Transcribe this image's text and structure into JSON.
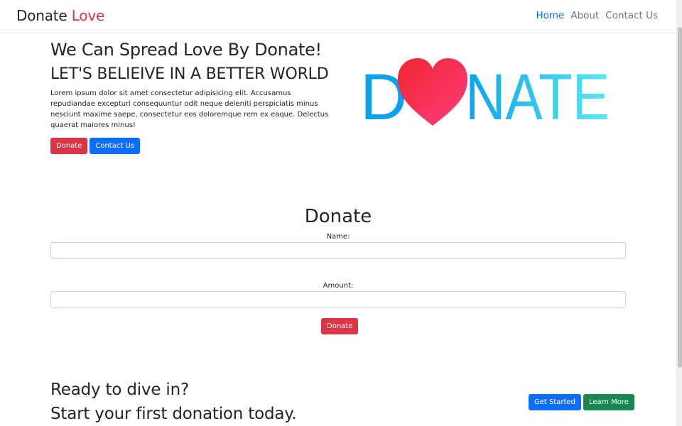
{
  "navbar": {
    "brand_main": "Donate",
    "brand_accent": "Love",
    "links": [
      "Home",
      "About",
      "Contact Us"
    ]
  },
  "hero": {
    "heading": "We Can Spread Love By Donate!",
    "subheading": "LET'S BELIEIVE IN A BETTER WORLD",
    "body": "Lorem ipsum dolor sit amet consectetur adipisicing elit. Accusamus repudiandae excepturi consequuntur odit neque deleniti perspiciatis minus nesciunt maxime saepe, consectetur eos doloremque rem ex eaque. Delectus quaerat maiores minus!",
    "donate_button": "Donate",
    "contact_button": "Contact Us"
  },
  "logo": {
    "letters_left": "D",
    "letters_right": "NATE"
  },
  "form": {
    "title": "Donate",
    "name_label": "Name:",
    "name_value": "",
    "amount_label": "Amount:",
    "amount_value": "",
    "submit_label": "Donate"
  },
  "cta": {
    "line1": "Ready to dive in?",
    "line2": "Start your first donation today.",
    "get_started": "Get Started",
    "learn_more": "Learn More"
  },
  "colors": {
    "primary": "#0d6efd",
    "danger": "#dc3545",
    "success": "#198754",
    "logo_gradient_start": "#0aa2f0",
    "logo_gradient_end": "#5fe8f0",
    "heart_start": "#f0262e",
    "heart_end": "#ff3d7f"
  }
}
